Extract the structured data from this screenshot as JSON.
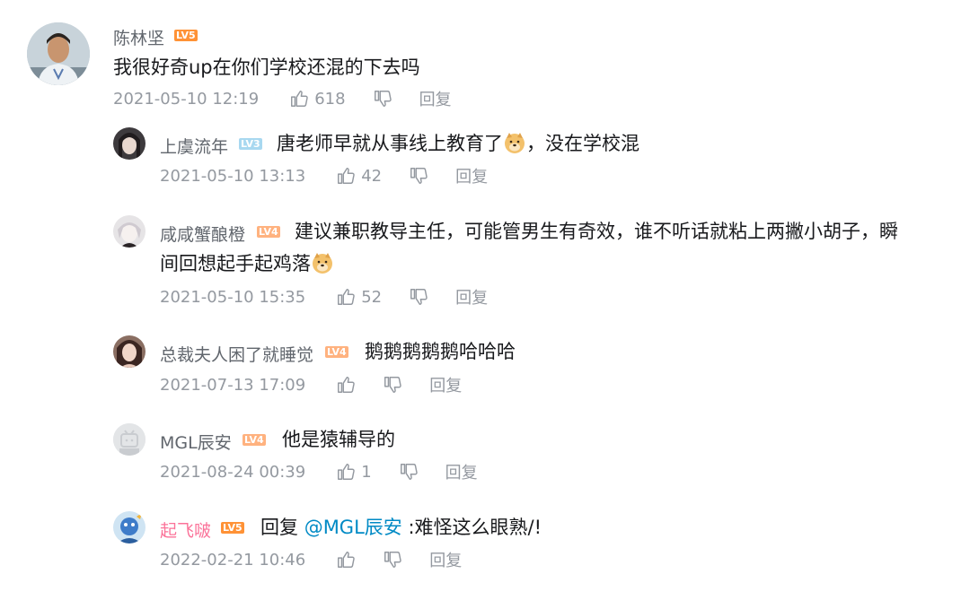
{
  "main_comment": {
    "username": "陈林坚",
    "level": "LV5",
    "text": "我很好奇up在你们学校还混的下去吗",
    "time": "2021-05-10 12:19",
    "likes": "618",
    "reply_label": "回复"
  },
  "replies": [
    {
      "username": "上虞流年",
      "level": "LV3",
      "text_before": "唐老师早就从事线上教育了",
      "text_after": "，没在学校混",
      "time": "2021-05-10 13:13",
      "likes": "42",
      "reply_label": "回复"
    },
    {
      "username": "咸咸蟹酿橙",
      "level": "LV4",
      "text_line1": "建议兼职教导主任，可能管男生有奇效，谁不听话就粘上两撇小胡子，瞬",
      "text_line2": "间回想起手起鸡落",
      "time": "2021-05-10 15:35",
      "likes": "52",
      "reply_label": "回复"
    },
    {
      "username": "总裁夫人困了就睡觉",
      "level": "LV4",
      "text": "鹅鹅鹅鹅鹅哈哈哈",
      "time": "2021-07-13 17:09",
      "likes": "",
      "reply_label": "回复"
    },
    {
      "username": "MGL辰安",
      "level": "LV4",
      "text": "他是猿辅导的",
      "time": "2021-08-24 00:39",
      "likes": "1",
      "reply_label": "回复"
    },
    {
      "username": "起飞啵",
      "level": "LV5",
      "reply_prefix": "回复",
      "mention": "@MGL辰安",
      "text": " :难怪这么眼熟/!",
      "time": "2022-02-21 10:46",
      "likes": "",
      "reply_label": "回复"
    }
  ],
  "icons": {
    "like": "thumbs-up-icon",
    "dislike": "thumbs-down-icon",
    "emoji": "doge-emoji"
  },
  "colors": {
    "username": "#61666d",
    "vip_username": "#fb7299",
    "mention": "#008ac5",
    "meta": "#9499a0",
    "lv5": "#ff9236",
    "lv4": "#ffb27f",
    "lv3": "#a8d8f0"
  }
}
